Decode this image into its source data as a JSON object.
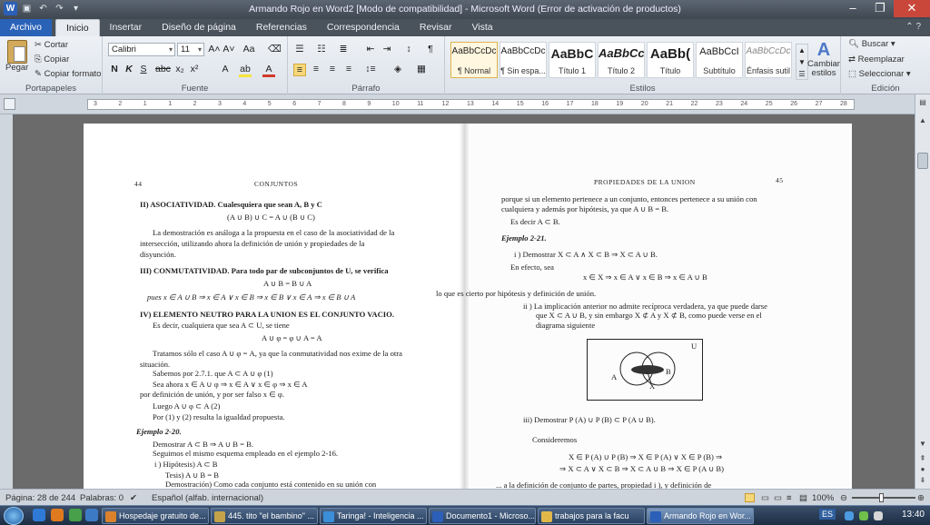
{
  "window": {
    "title": "Armando Rojo en Word2 [Modo de compatibilidad]  -  Microsoft Word (Error de activación de productos)",
    "controls": [
      "–",
      "❐",
      "✕"
    ]
  },
  "tabs": [
    "Archivo",
    "Inicio",
    "Insertar",
    "Diseño de página",
    "Referencias",
    "Correspondencia",
    "Revisar",
    "Vista"
  ],
  "active_tab": "Inicio",
  "ribbon": {
    "clipboard": {
      "label": "Portapapeles",
      "paste": "Pegar",
      "cut": "Cortar",
      "copy": "Copiar",
      "format_painter": "Copiar formato"
    },
    "font": {
      "label": "Fuente",
      "family": "Calibri",
      "size": "11"
    },
    "paragraph": {
      "label": "Párrafo"
    },
    "styles": {
      "label": "Estilos",
      "items": [
        {
          "sample": "AaBbCcDc",
          "name": "¶ Normal"
        },
        {
          "sample": "AaBbCcDc",
          "name": "¶ Sin espa..."
        },
        {
          "sample": "AaBbC",
          "name": "Título 1"
        },
        {
          "sample": "AaBbCc",
          "name": "Título 2"
        },
        {
          "sample": "AaBb(",
          "name": "Título"
        },
        {
          "sample": "AaBbCcI",
          "name": "Subtítulo"
        },
        {
          "sample": "AaBbCcDc",
          "name": "Énfasis sutil"
        }
      ],
      "change_styles": "Cambiar estilos"
    },
    "editing": {
      "label": "Edición",
      "find": "Buscar",
      "replace": "Reemplazar",
      "select": "Seleccionar"
    }
  },
  "ruler": {
    "numbers": [
      "3",
      "2",
      "1",
      "1",
      "2",
      "3",
      "4",
      "5",
      "6",
      "7",
      "8",
      "9",
      "10",
      "11",
      "12",
      "13",
      "14",
      "15",
      "16",
      "17",
      "18",
      "19",
      "20",
      "21",
      "22",
      "23",
      "24",
      "25",
      "26",
      "27",
      "28"
    ]
  },
  "page_left": {
    "page_number": "44",
    "header": "CONJUNTOS",
    "lines": [
      "II) ASOCIATIVIDAD. Cualesquiera que sean A, B y C",
      "(A ∪ B) ∪ C = A ∪ (B ∪ C)",
      "La demostración es análoga a la propuesta en el caso de la asociatividad de la",
      "intersección, utilizando ahora la definición de unión y propiedades de la",
      "disyunción.",
      "III) CONMUTATIVIDAD. Para todo par de subconjuntos de U, se verifica",
      "A ∪ B = B ∪ A",
      "pues   x ∈ A ∪ B ⇒ x ∈ A  ∨  x ∈ B ⇒ x ∈ B  ∨  x ∈ A ⇒ x ∈ B ∪ A",
      "IV) ELEMENTO NEUTRO PARA LA UNION ES EL CONJUNTO VACIO.",
      "Es decir, cualquiera que sea A ⊂ U, se tiene",
      "A ∪ φ = φ ∪ A = A",
      "Tratamos sólo el caso A ∪ φ = A, ya que la conmutatividad nos exime de la otra",
      "situación.",
      "Sabemos por 2.7.1. que A ⊂ A ∪ φ        (1)",
      "Sea ahora x ∈ A ∪ φ ⇒ x ∈ A  ∨  x ∈ φ ⇒ x ∈ A",
      "por definición de unión, y por ser falso x ∈ φ.",
      "Luego  A ∪ φ ⊂ A        (2)",
      "Por (1) y (2) resulta la igualdad propuesta.",
      "Ejemplo 2-20.",
      "Demostrar  A ⊂ B ⇒ A ∪ B = B.",
      "Seguimos el mismo esquema empleado en el ejemplo 2-16.",
      "i ) Hipótesis)  A ⊂ B",
      "Tesis)  A ∪ B = B",
      "Demostración)  Como cada conjunto está contenido en su unión con"
    ]
  },
  "page_right": {
    "page_number": "45",
    "header": "PROPIEDADES DE LA UNION",
    "lines": [
      "porque si un elemento pertenece a un conjunto, entonces pertenece a su unión con",
      "cualquiera y además por hipótesis, ya que A ∪ B = B.",
      "Es decir   A ⊂ B.",
      "Ejemplo 2-21.",
      "i ) Demostrar  X ⊂ A  ∧  X ⊂ B ⇒ X ⊂ A ∪ B.",
      "En efecto, sea",
      "x ∈ X ⇒ x ∈ A  ∨  x ∈ B ⇒ x ∈ A ∪ B",
      "lo que es cierto por hipótesis y definición de unión.",
      "ii ) La implicación anterior no admite recíproca verdadera, ya que puede darse",
      "que X ⊂ A ∪ B, y sin embargo X ⊄ A y X ⊄ B, como puede verse en el",
      "diagrama siguiente",
      "iii) Demostrar  P (A) ∪ P (B) ⊂ P (A ∪ B).",
      "Consideremos",
      "X ∈ P (A) ∪ P (B) ⇒ X ∈ P (A)  ∨  X ∈ P (B) ⇒",
      "⇒ X ⊂ A  ∨  X ⊂ B ⇒ X ⊂ A ∪ B ⇒ X ∈ P (A ∪ B)",
      "... a la definición de conjunto de partes, propiedad i ), y definición de"
    ],
    "venn_labels": {
      "universe": "U",
      "a": "A",
      "b": "B",
      "x": "X"
    }
  },
  "status": {
    "page": "Página: 28 de 244",
    "words": "Palabras: 0",
    "language": "Español (alfab. internacional)",
    "zoom": "100%"
  },
  "taskbar": {
    "items": [
      {
        "label": "Hospedaje gratuito de...",
        "color": "#d9822b"
      },
      {
        "label": "445. tito \"el bambino\" ...",
        "color": "#c5a34a"
      },
      {
        "label": "Taringa! - Inteligencia ...",
        "color": "#3b8ed8"
      },
      {
        "label": "Documento1 - Microso...",
        "color": "#2b5fb8"
      },
      {
        "label": "trabajos para la facu",
        "color": "#e0b84a"
      },
      {
        "label": "Armando Rojo en Wor...",
        "color": "#2b5fb8"
      }
    ],
    "language_indicator": "ES",
    "clock": "13:40"
  }
}
